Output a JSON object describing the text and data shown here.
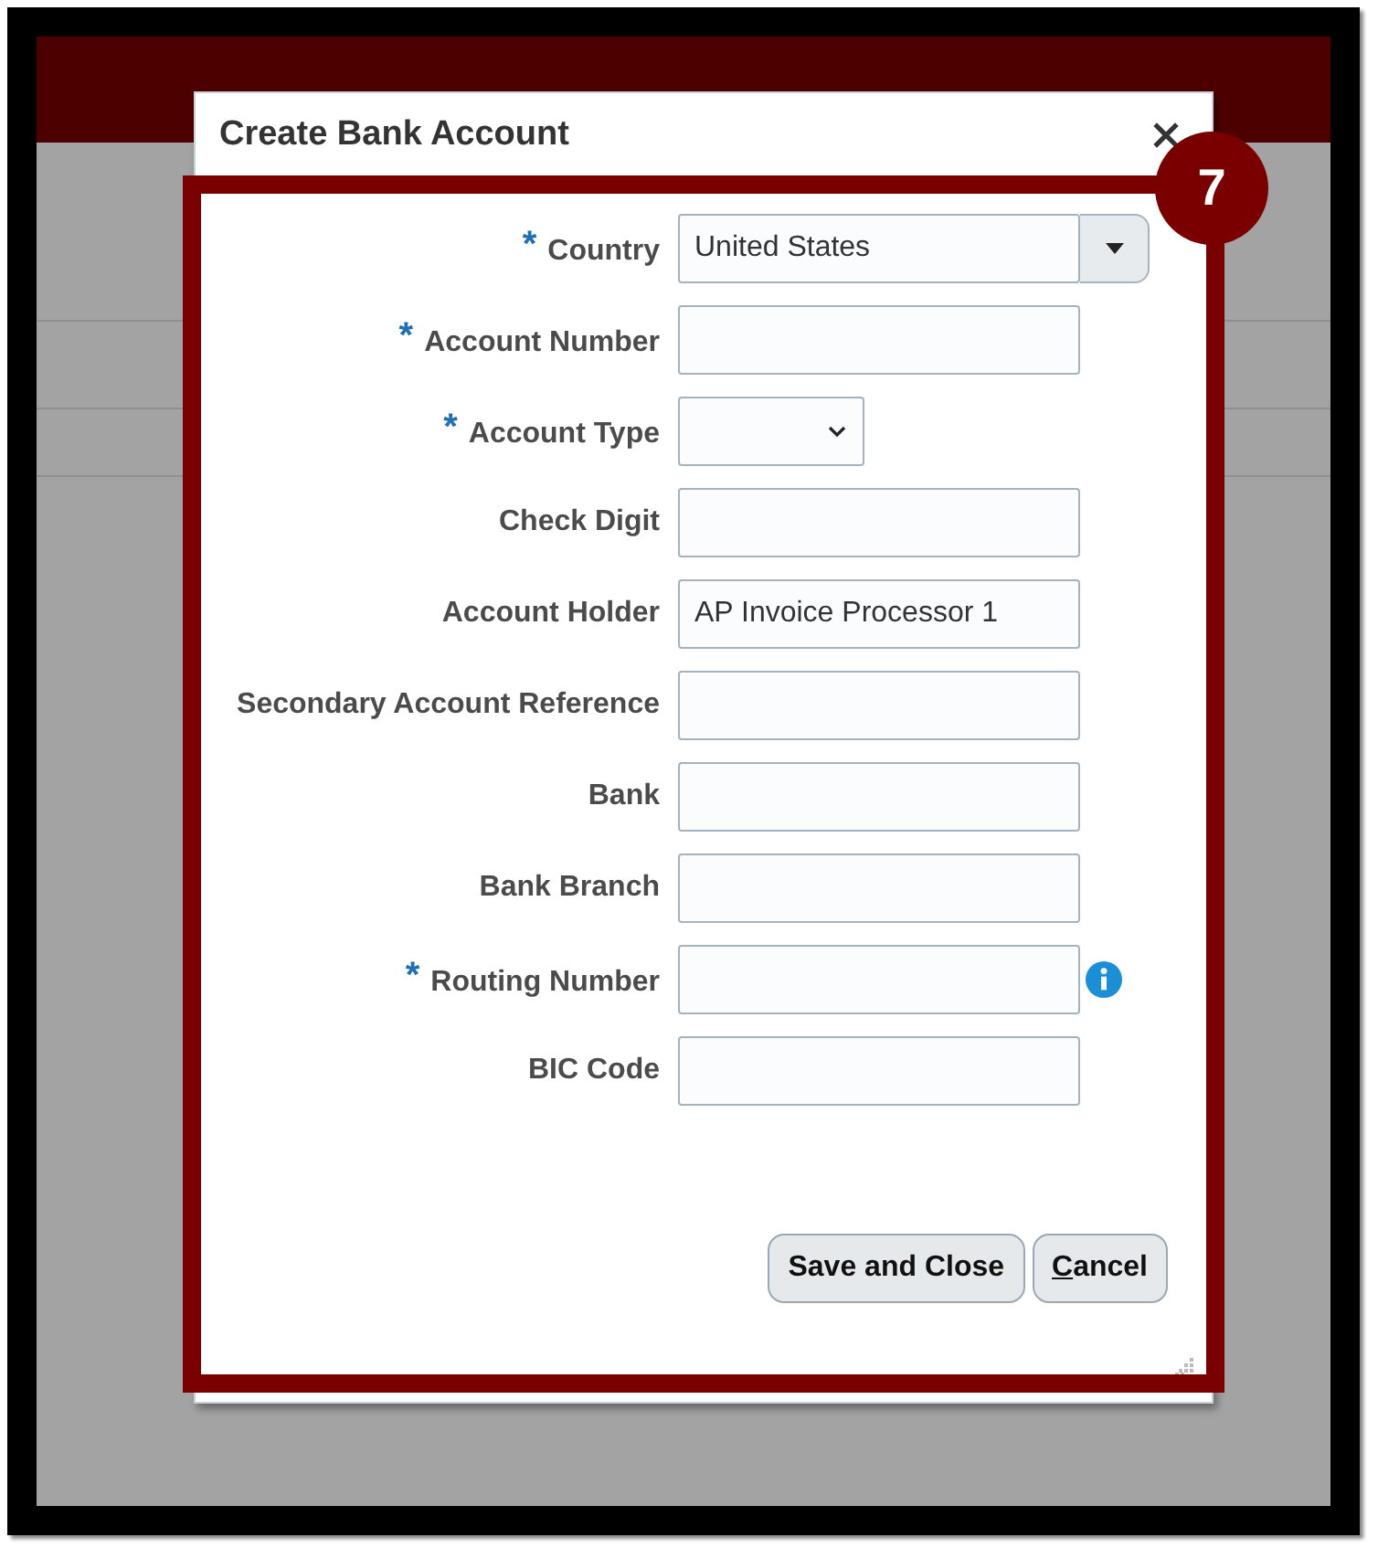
{
  "dialog": {
    "title": "Create Bank Account"
  },
  "annotation": {
    "step": "7"
  },
  "fields": [
    {
      "label": "Country",
      "marker": "*",
      "kind": "combo",
      "value": "United States",
      "info": false
    },
    {
      "label": "Account Number",
      "marker": "*",
      "kind": "text",
      "info": false
    },
    {
      "label": "Account Type",
      "marker": "*",
      "kind": "select",
      "info": false
    },
    {
      "label": "Check Digit",
      "kind": "text",
      "info": false
    },
    {
      "label": "Account Holder",
      "kind": "text",
      "value": "AP Invoice Processor 1",
      "info": false
    },
    {
      "label": "Secondary Account Reference",
      "kind": "text",
      "info": false
    },
    {
      "label": "Bank",
      "kind": "text",
      "info": false
    },
    {
      "label": "Bank Branch",
      "kind": "text",
      "info": false
    },
    {
      "label": "Routing Number",
      "marker": "*",
      "kind": "text",
      "info": true
    },
    {
      "label": "BIC Code",
      "kind": "text",
      "info": false
    }
  ],
  "buttons": [
    {
      "label": "Save and Close",
      "underline_first": false
    },
    {
      "label": "Cancel",
      "underline_first": true
    }
  ]
}
